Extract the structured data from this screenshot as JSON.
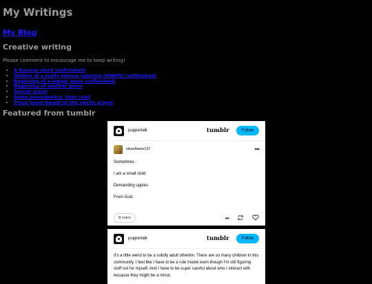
{
  "page": {
    "title": "My Writings",
    "blog_link": "My Blog",
    "creative_heading": "Creative writing",
    "intro": "Please comment to encourage me to keep writing!",
    "links": [
      "A Russian short (unfinished)",
      "Outline of a really sincere painting (WWPN) (unfinished)",
      "Beginning of a longer piece (unfinished)",
      "Beginning of another piece",
      "Sunset scene",
      "Some prose/poetry: Deer road",
      "Prose poem based on the spirits prayer"
    ],
    "featured_heading": "Featured from tumblr"
  },
  "posts": [
    {
      "author": "puppertalk",
      "logo": "tumblr",
      "follow_label": "Follow",
      "reblog_author": "silverflame137",
      "lines": [
        "Sometimes",
        "I am a small child",
        "Demanding uppies",
        "From God."
      ],
      "notes_count": "3",
      "notes_label": "notes"
    },
    {
      "author": "puppertalk",
      "logo": "tumblr",
      "follow_label": "Follow",
      "text": "It's a little weird to be a solidly adult otherkin. There are so many children in this community. I feel like I have to be a role model even though I'm still figuring stuff out for myself. And I have to be super careful about who I interact with because they might be a minor."
    }
  ],
  "colors": {
    "background": "#000000",
    "link": "#1a1aff",
    "follow_button": "#00b8ff",
    "heading": "#9a9a9a"
  },
  "icons": [
    "more-icon",
    "reblog-icon",
    "heart-icon",
    "avatar"
  ]
}
